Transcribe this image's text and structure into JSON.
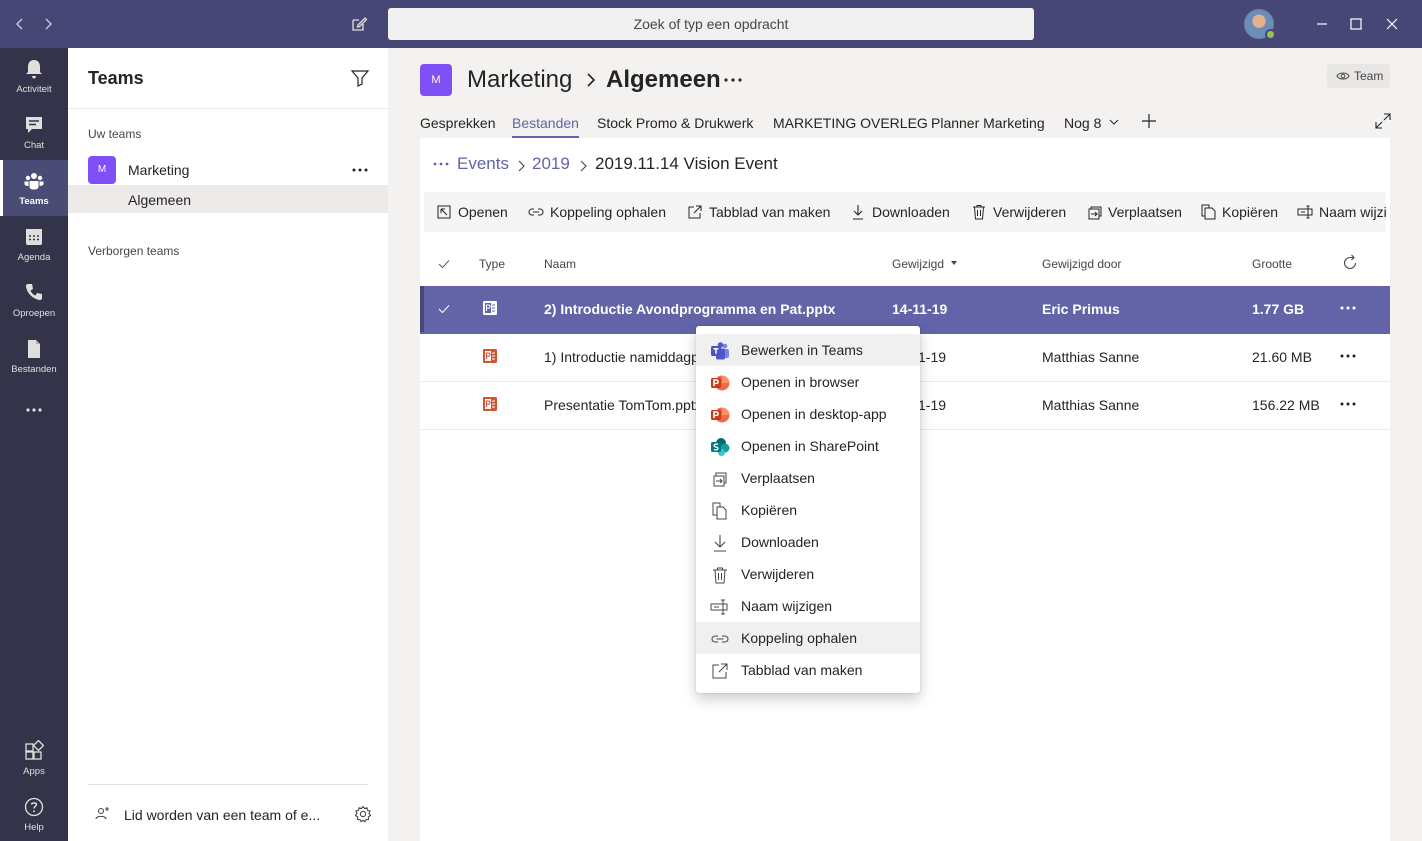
{
  "search": {
    "placeholder": "Zoek of typ een opdracht"
  },
  "rail": [
    {
      "label": "Activiteit",
      "icon": "bell-icon"
    },
    {
      "label": "Chat",
      "icon": "chat-icon"
    },
    {
      "label": "Teams",
      "icon": "teams-icon",
      "active": true
    },
    {
      "label": "Agenda",
      "icon": "calendar-icon"
    },
    {
      "label": "Oproepen",
      "icon": "phone-icon"
    },
    {
      "label": "Bestanden",
      "icon": "file-icon"
    }
  ],
  "rail_bottom": [
    {
      "label": "Apps",
      "icon": "apps-icon"
    },
    {
      "label": "Help",
      "icon": "help-icon"
    }
  ],
  "teams_pane": {
    "title": "Teams",
    "your_teams": "Uw teams",
    "team": {
      "initial": "M",
      "name": "Marketing"
    },
    "channel": "Algemeen",
    "hidden_teams": "Verborgen teams",
    "join_label": "Lid worden van een team of e..."
  },
  "header": {
    "team_initial": "M",
    "team": "Marketing",
    "channel": "Algemeen",
    "team_button": "Team"
  },
  "tabs": [
    {
      "label": "Gesprekken"
    },
    {
      "label": "Bestanden",
      "active": true
    },
    {
      "label": "Stock Promo & Drukwerk"
    },
    {
      "label": "MARKETING OVERLEG"
    },
    {
      "label": "Planner Marketing"
    },
    {
      "label": "Nog 8"
    }
  ],
  "path": [
    "Events",
    "2019",
    "2019.11.14 Vision Event"
  ],
  "commands": [
    "Openen",
    "Koppeling ophalen",
    "Tabblad van maken",
    "Downloaden",
    "Verwijderen",
    "Verplaatsen",
    "Kopiëren",
    "Naam wijzigen"
  ],
  "columns": {
    "type": "Type",
    "name": "Naam",
    "modified": "Gewijzigd",
    "modified_by": "Gewijzigd door",
    "size": "Grootte"
  },
  "files": [
    {
      "name": "2) Introductie Avondprogramma en Pat.pptx",
      "modified": "14-11-19",
      "modified_by": "Eric Primus",
      "size": "1.77 GB",
      "selected": true
    },
    {
      "name": "1) Introductie namiddagp",
      "modified": "1-19",
      "modified_by": "Matthias Sanne",
      "size": "21.60 MB"
    },
    {
      "name": "Presentatie TomTom.pptx",
      "modified": "1-19",
      "modified_by": "Matthias Sanne",
      "size": "156.22 MB"
    }
  ],
  "context_menu": [
    {
      "label": "Bewerken in Teams",
      "icon": "teams-app-icon"
    },
    {
      "label": "Openen in browser",
      "icon": "powerpoint-icon"
    },
    {
      "label": "Openen in desktop-app",
      "icon": "powerpoint-icon"
    },
    {
      "label": "Openen in SharePoint",
      "icon": "sharepoint-icon"
    },
    {
      "label": "Verplaatsen",
      "icon": "move-icon"
    },
    {
      "label": "Kopiëren",
      "icon": "copy-icon"
    },
    {
      "label": "Downloaden",
      "icon": "download-icon"
    },
    {
      "label": "Verwijderen",
      "icon": "trash-icon"
    },
    {
      "label": "Naam wijzigen",
      "icon": "rename-icon"
    },
    {
      "label": "Koppeling ophalen",
      "icon": "link-icon"
    },
    {
      "label": "Tabblad van maken",
      "icon": "open-tab-icon"
    }
  ],
  "colors": {
    "accent": "#6264a7",
    "titlebar": "#464775",
    "rail": "#33344a",
    "team_avatar": "#7f50f5",
    "powerpoint": "#d35230",
    "sharepoint": "#038387"
  }
}
